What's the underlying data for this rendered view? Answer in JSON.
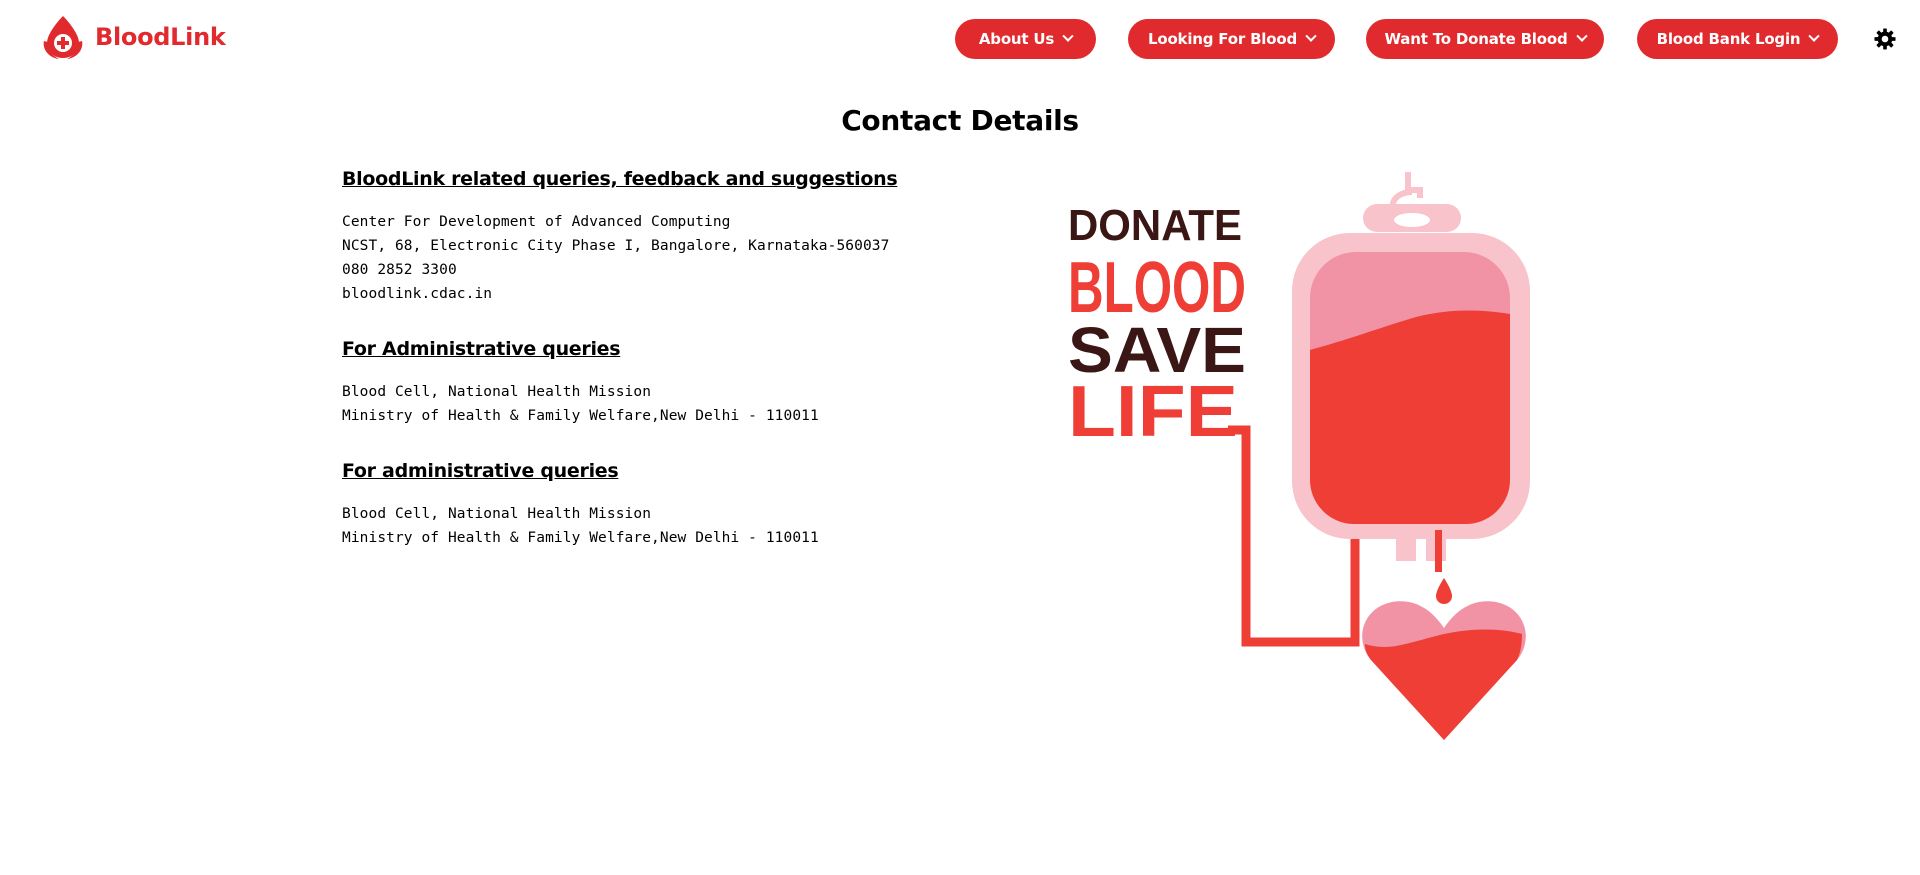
{
  "header": {
    "brand_name": "BloodLink",
    "logo_icon": "blood-drop-plus-icon",
    "settings_icon": "gear-icon",
    "nav": [
      {
        "label": "About Us"
      },
      {
        "label": "Looking For Blood"
      },
      {
        "label": "Want To Donate Blood"
      },
      {
        "label": "Blood Bank Login"
      }
    ]
  },
  "colors": {
    "brand_red": "#e02a2e",
    "blood_red": "#ee3e36",
    "light_pink": "#f8c3cb",
    "mid_pink": "#f293a5",
    "dark_text": "#3a1714"
  },
  "page": {
    "title": "Contact Details"
  },
  "sections": [
    {
      "heading": "BloodLink related queries, feedback and suggestions",
      "lines": [
        "Center For Development of Advanced Computing",
        "NCST, 68, Electronic City Phase I, Bangalore, Karnataka-560037",
        "080 2852 3300",
        "bloodlink.cdac.in"
      ]
    },
    {
      "heading": "For Administrative queries",
      "lines": [
        "Blood Cell, National Health Mission",
        "Ministry of Health & Family Welfare,New Delhi - 110011"
      ]
    },
    {
      "heading": "For administrative queries",
      "lines": [
        "Blood Cell, National Health Mission",
        "Ministry of Health & Family Welfare,New Delhi - 110011"
      ]
    }
  ],
  "illustration": {
    "words": [
      "DONATE",
      "BLOOD",
      "SAVE",
      "LIFE"
    ]
  }
}
